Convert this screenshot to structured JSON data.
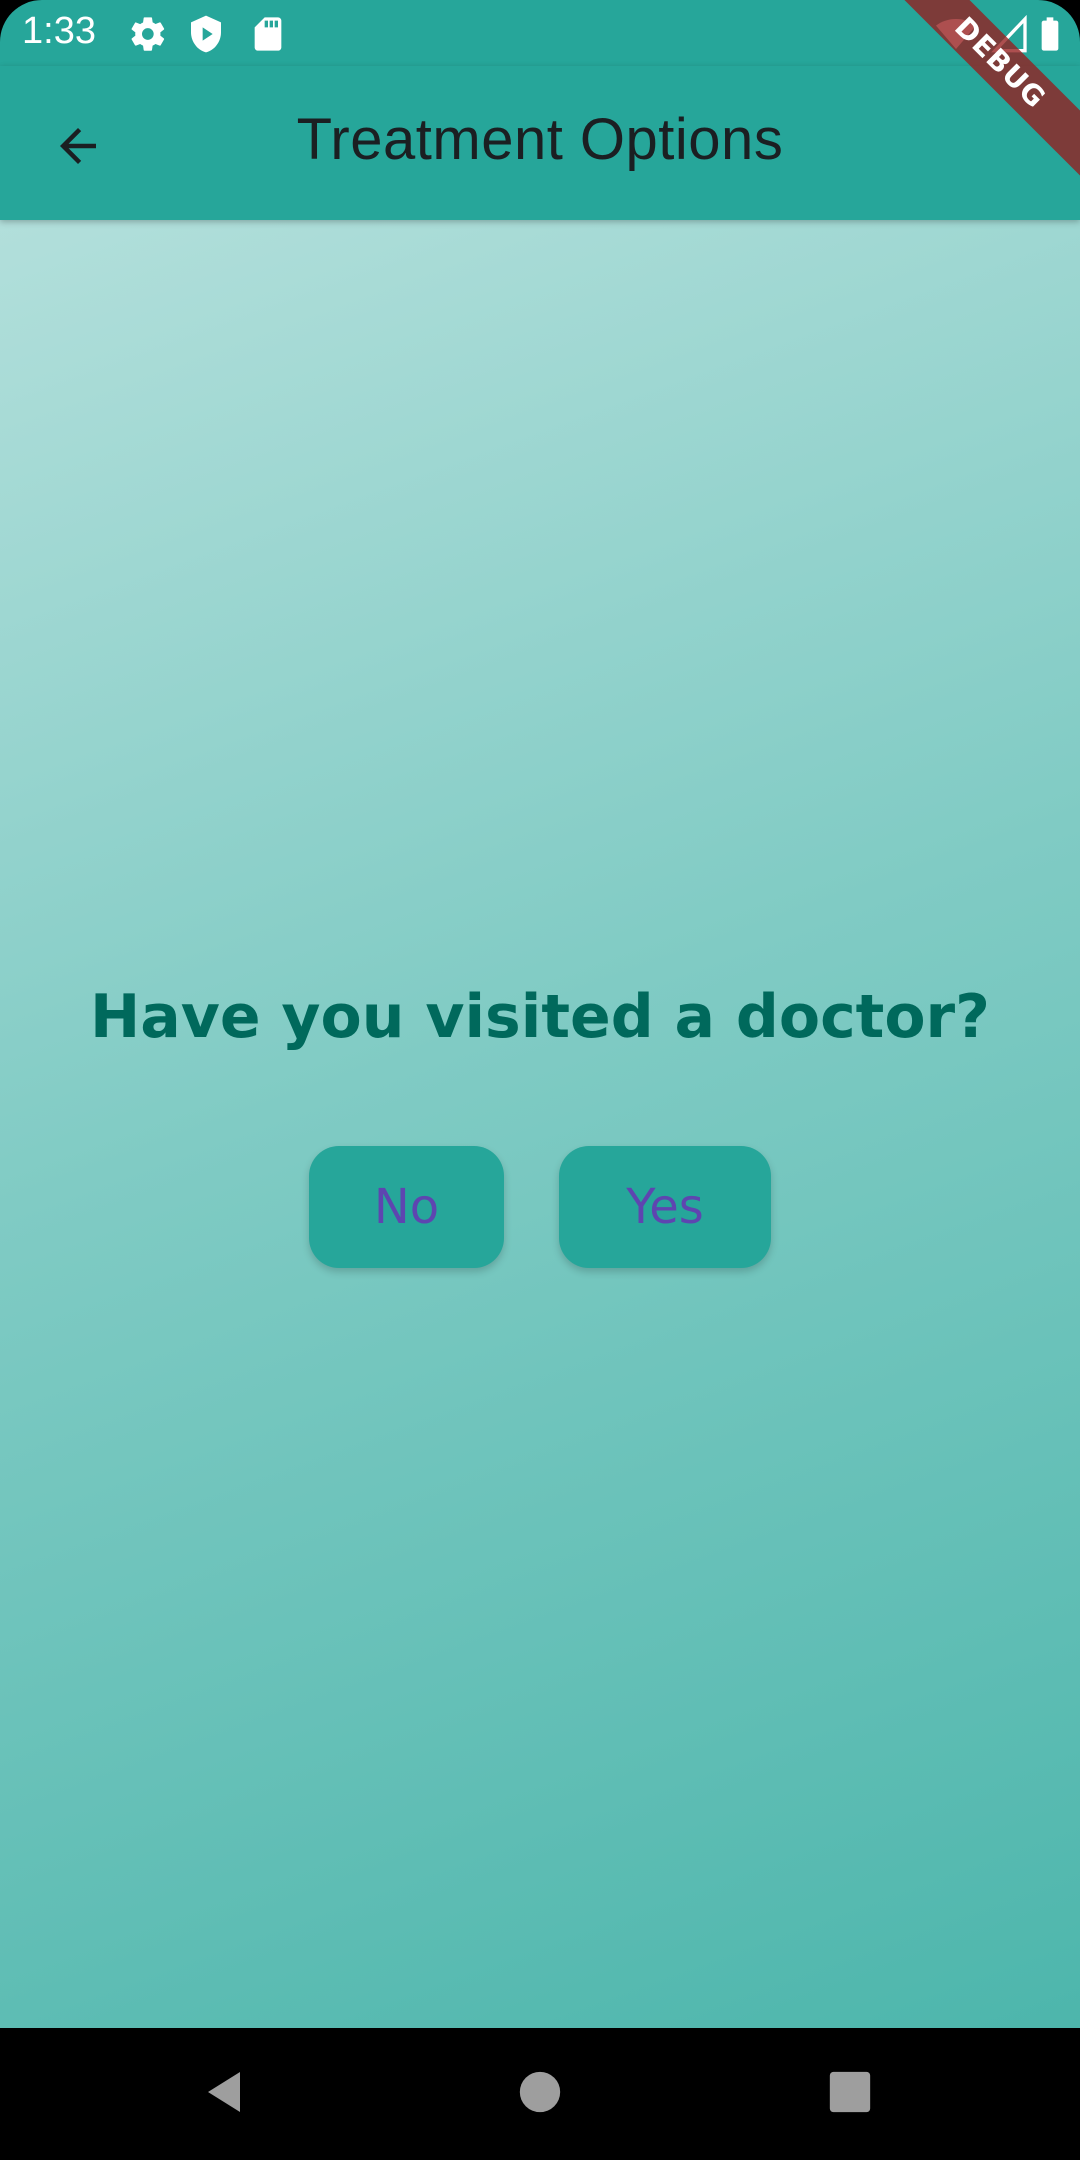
{
  "status_bar": {
    "time": "1:33",
    "left_icons": [
      "gear-icon",
      "shield-play-icon",
      "sd-card-icon"
    ],
    "right_icons": [
      "wifi-icon",
      "signal-icon",
      "battery-icon"
    ]
  },
  "debug_banner": "DEBUG",
  "app_bar": {
    "title": "Treatment Options",
    "back_icon": "arrow-back-icon"
  },
  "main": {
    "question": "Have you visited a doctor?",
    "buttons": [
      {
        "label": "No"
      },
      {
        "label": "Yes"
      }
    ]
  },
  "nav_bar": {
    "icons": [
      "back-triangle-icon",
      "home-circle-icon",
      "recents-square-icon"
    ]
  },
  "colors": {
    "primary": "#26A69A",
    "question_text": "#00695C",
    "button_text": "#5E45B0",
    "gradient_start": "#B2DFDB",
    "gradient_end": "#4DB6AC"
  }
}
